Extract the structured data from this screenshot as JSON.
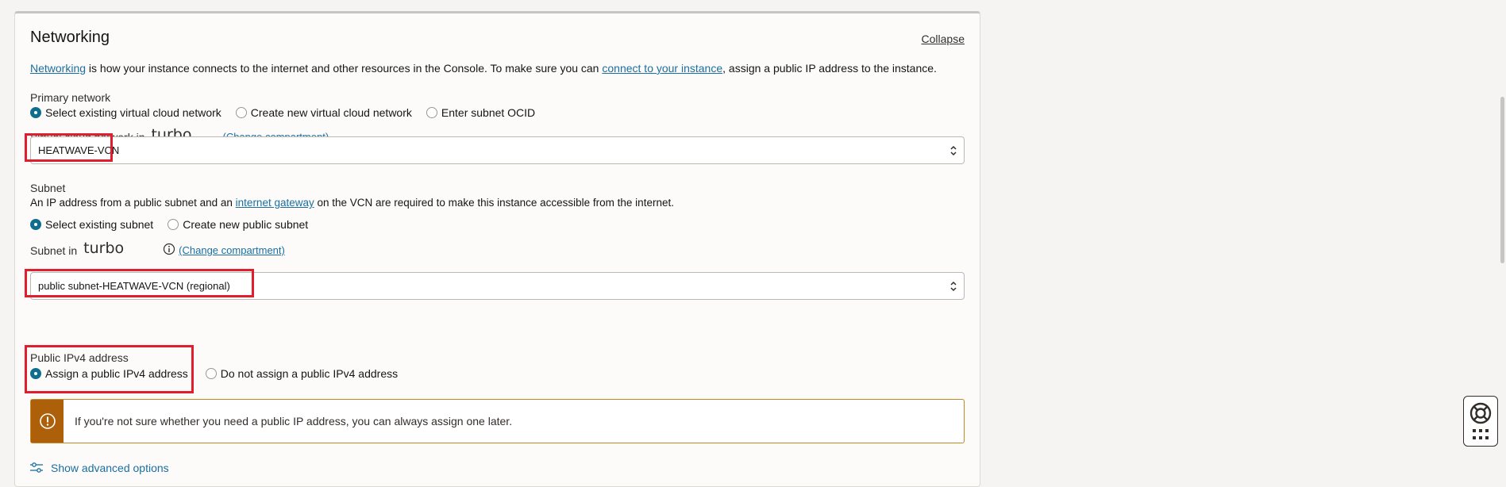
{
  "section": {
    "title": "Networking",
    "collapse_label": "Collapse",
    "description": {
      "link1": "Networking",
      "text1": " is how your instance connects to the internet and other resources in the Console. To make sure you can ",
      "link2": "connect to your instance",
      "text2": ", assign a public IP address to the instance."
    }
  },
  "primary_network": {
    "label": "Primary network",
    "options": [
      "Select existing virtual cloud network",
      "Create new virtual cloud network",
      "Enter subnet OCID"
    ],
    "selected": 0
  },
  "vcn": {
    "label": "Virtual cloud network in",
    "compartment": "turbo",
    "change_link": "(Change compartment)",
    "value": "HEATWAVE-VCN"
  },
  "subnet": {
    "label": "Subnet",
    "help": {
      "text1": "An IP address from a public subnet and an ",
      "link": "internet gateway",
      "text2": " on the VCN are required to make this instance accessible from the internet."
    },
    "options": [
      "Select existing subnet",
      "Create new public subnet"
    ],
    "selected": 0,
    "in_label": "Subnet in",
    "compartment": "turbo",
    "change_link": "(Change compartment)",
    "value": "public subnet-HEATWAVE-VCN (regional)"
  },
  "public_ip": {
    "label": "Public IPv4 address",
    "options": [
      "Assign a public IPv4 address",
      "Do not assign a public IPv4 address"
    ],
    "selected": 0
  },
  "warning": {
    "text": "If you're not sure whether you need a public IP address, you can always assign one later."
  },
  "advanced": {
    "label": "Show advanced options"
  },
  "colors": {
    "link": "#1a6fa0",
    "radio_selected": "#0f6e8e",
    "highlight_box": "#e01e2e",
    "warning_side": "#ad5f0a"
  }
}
